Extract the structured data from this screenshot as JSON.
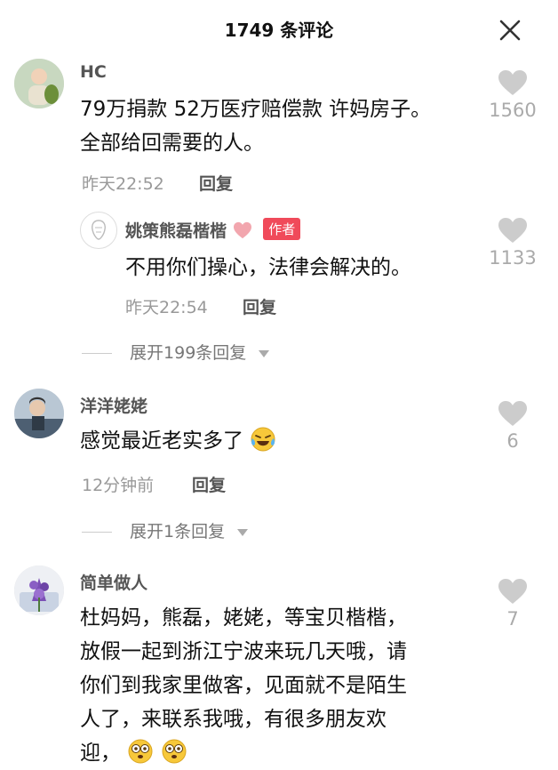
{
  "header": {
    "title": "1749 条评论",
    "close_icon": "close-icon"
  },
  "comments": [
    {
      "name": "HC",
      "text_lines": [
        "79万捐款 52万医疗赔偿款 许妈房子。",
        "全部给回需要的人。"
      ],
      "time": "昨天22:52",
      "reply_label": "回复",
      "likes": "1560",
      "reply": {
        "name": "姚策熊磊楷楷",
        "badge": "作者",
        "text": "不用你们操心，法律会解决的。",
        "time": "昨天22:54",
        "reply_label": "回复",
        "likes": "1133"
      },
      "expand_label": "展开199条回复"
    },
    {
      "name": "洋洋姥姥",
      "text": "感觉最近老实多了",
      "time": "12分钟前",
      "reply_label": "回复",
      "likes": "6",
      "expand_label": "展开1条回复"
    },
    {
      "name": "简单做人",
      "text_lines": [
        "杜妈妈，熊磊，姥姥，等宝贝楷楷，",
        "放假一起到浙江宁波来玩几天哦，请",
        "你们到我家里做客，见面就不是陌生",
        "人了，来联系我哦，有很多朋友欢",
        "迎，"
      ],
      "likes": "7"
    }
  ],
  "colors": {
    "accent_badge": "#f04a5a",
    "muted": "#999999",
    "heart": "#cccccc"
  }
}
